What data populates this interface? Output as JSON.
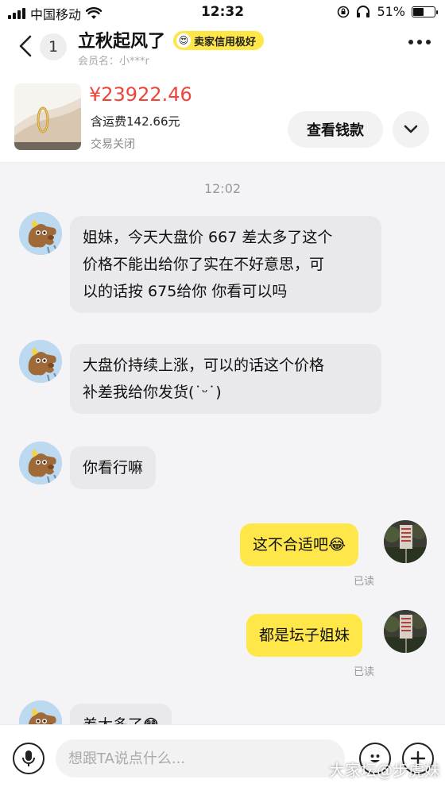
{
  "status_bar": {
    "carrier": "中国移动",
    "time": "12:32",
    "battery": "51%",
    "battery_level": 0.51
  },
  "header": {
    "unread_count": "1",
    "seller_name": "立秋起风了",
    "credit_badge": "卖家信用极好",
    "member": "会员名：小***r"
  },
  "product": {
    "price": "¥23922.46",
    "shipping": "含运费142.66元",
    "status": "交易关闭",
    "view_button": "查看钱款"
  },
  "chat": {
    "timestamp": "12:02",
    "messages": [
      {
        "from": "seller",
        "lines": [
          "姐妹，今天大盘价 667 差太多了这个",
          "价格不能出给你了实在不好意思，可",
          "以的话按 675给你 你看可以吗"
        ]
      },
      {
        "from": "seller",
        "lines": [
          "大盘价持续上涨，可以的话这个价格",
          "补差我给你发货(˙ᵕ˙)"
        ]
      },
      {
        "from": "seller",
        "lines": [
          "你看行嘛"
        ]
      },
      {
        "from": "self",
        "text": "这不合适吧",
        "emoji": "😂",
        "read": "已读"
      },
      {
        "from": "self",
        "text": "都是坛子姐妹",
        "read": "已读"
      },
      {
        "from": "seller",
        "text": "差太多了",
        "emoji": "😳"
      }
    ]
  },
  "input": {
    "placeholder": "想跟TA说点什么..."
  },
  "watermark": "大家坛@步虎妹",
  "colors": {
    "price": "#f0433a",
    "accent_yellow": "#ffe74a",
    "incoming_bubble": "#e9e9ec",
    "background": "#f4f4f6"
  },
  "icons": [
    "signal-icon",
    "wifi-icon",
    "lock-rotation-icon",
    "headphones-icon",
    "battery-icon",
    "back-icon",
    "more-icon",
    "chevron-down-icon",
    "voice-icon",
    "emoji-icon",
    "plus-icon"
  ]
}
